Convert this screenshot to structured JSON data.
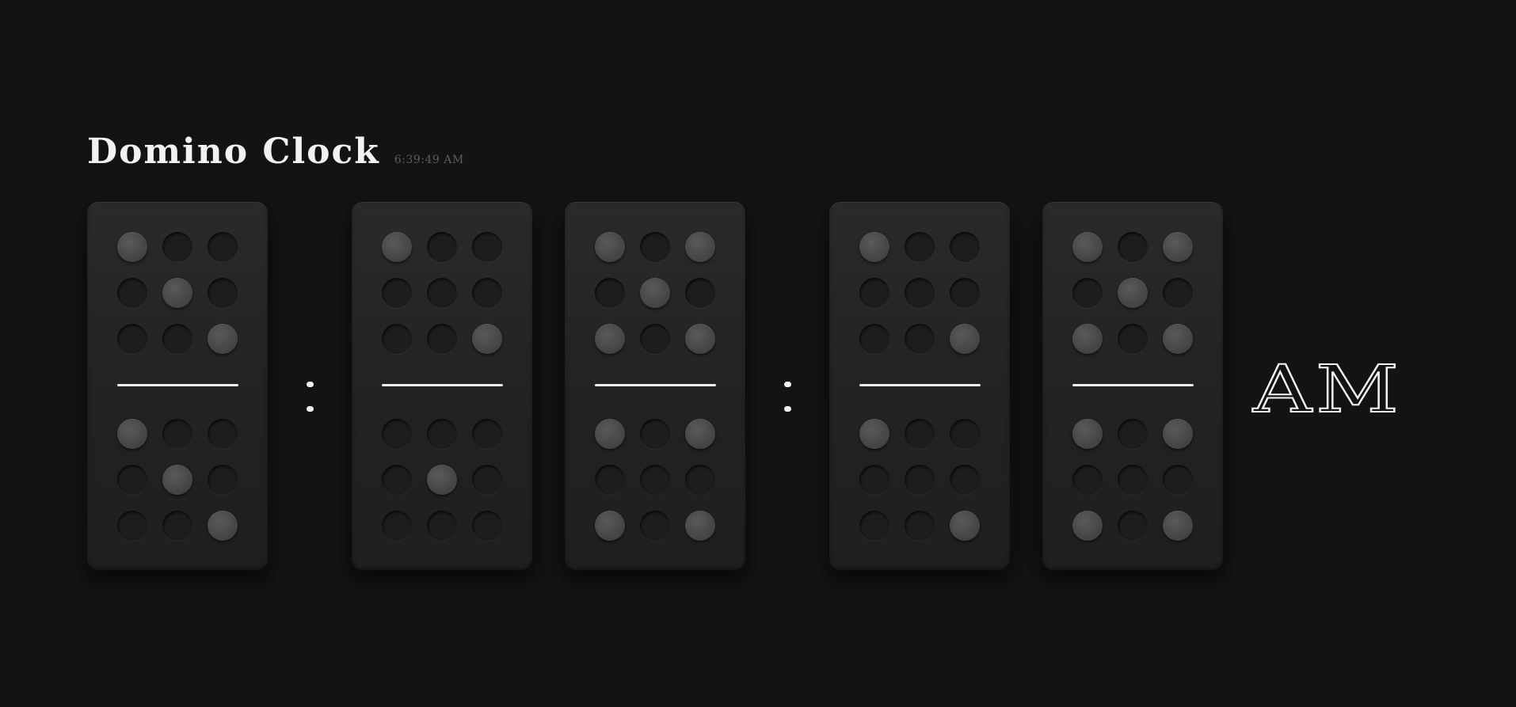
{
  "title": "Domino Clock",
  "current_time": "6:39:49 AM",
  "meridiem": "AM",
  "colors": {
    "background": "#131313",
    "tile": "#252525",
    "pip_on": "#4a4a4a",
    "pip_off": "#1d1d1d",
    "accent": "#f2f2f2"
  },
  "clock": {
    "groups": [
      {
        "name": "hours",
        "dominoes": [
          {
            "top": [
              1,
              0,
              0,
              0,
              1,
              0,
              0,
              0,
              1
            ],
            "bottom": [
              1,
              0,
              0,
              0,
              1,
              0,
              0,
              0,
              1
            ]
          }
        ]
      },
      {
        "name": "minutes",
        "dominoes": [
          {
            "top": [
              1,
              0,
              0,
              0,
              0,
              0,
              0,
              0,
              1
            ],
            "bottom": [
              0,
              0,
              0,
              0,
              1,
              0,
              0,
              0,
              0
            ]
          },
          {
            "top": [
              1,
              0,
              1,
              0,
              1,
              0,
              1,
              0,
              1
            ],
            "bottom": [
              1,
              0,
              1,
              0,
              0,
              0,
              1,
              0,
              1
            ]
          }
        ]
      },
      {
        "name": "seconds",
        "dominoes": [
          {
            "top": [
              1,
              0,
              0,
              0,
              0,
              0,
              0,
              0,
              1
            ],
            "bottom": [
              1,
              0,
              0,
              0,
              0,
              0,
              0,
              0,
              1
            ]
          },
          {
            "top": [
              1,
              0,
              1,
              0,
              1,
              0,
              1,
              0,
              1
            ],
            "bottom": [
              1,
              0,
              1,
              0,
              0,
              0,
              1,
              0,
              1
            ]
          }
        ]
      }
    ]
  }
}
